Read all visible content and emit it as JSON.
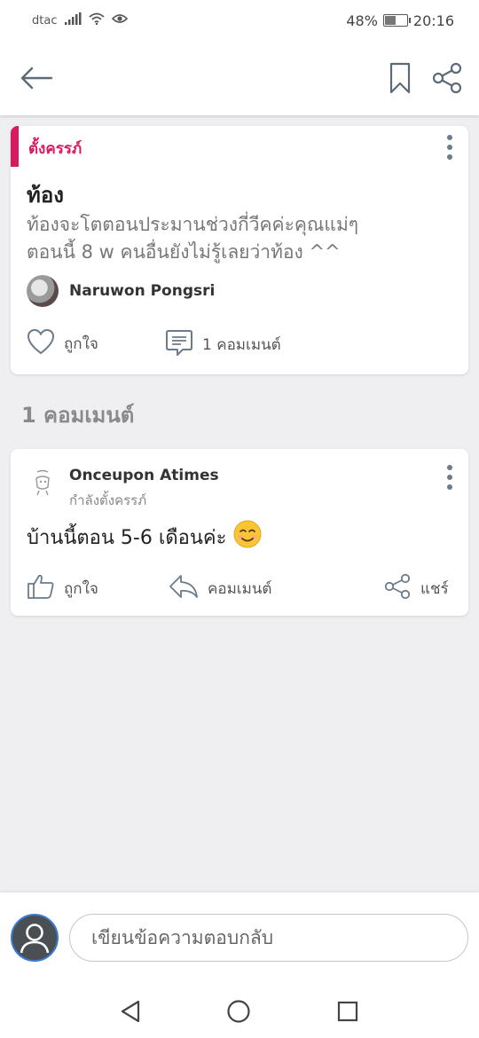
{
  "status_bar": {
    "carrier": "dtac",
    "battery_text": "48%",
    "battery_level": 0.48,
    "time": "20:16",
    "icons": [
      "signal-icon",
      "wifi-icon",
      "eye-icon",
      "battery-icon"
    ]
  },
  "app_bar": {
    "icons": [
      "back-arrow-icon",
      "bookmark-icon",
      "share-icon"
    ]
  },
  "post": {
    "tag": "ตั้งครรภ์",
    "tag_color": "#d81b60",
    "title": "ท้อง",
    "body_line1": "ท้องจะโตตอนประมานช่วงกี่วีคค่ะคุณแม่ๆ",
    "body_line2": "ตอนนี้ 8 w คนอื่นยังไม่รู้เลยว่าท้อง ^^",
    "author": "Naruwon Pongsri",
    "like_label": "ถูกใจ",
    "comment_label": "1 คอมเมนต์"
  },
  "comments_heading": "1 คอมเมนต์",
  "comment": {
    "author": "Onceupon Atimes",
    "status": "กำลังตั้งครรภ์",
    "text": "บ้านนี้ตอน 5-6 เดือนค่ะ",
    "emoji": "😊",
    "like_label": "ถูกใจ",
    "reply_label": "คอมเมนต์",
    "share_label": "แชร์"
  },
  "reply_bar": {
    "placeholder": "เขียนข้อความตอบกลับ"
  },
  "nav_bar": {
    "icons": [
      "back-triangle-icon",
      "home-circle-icon",
      "recents-square-icon"
    ]
  }
}
